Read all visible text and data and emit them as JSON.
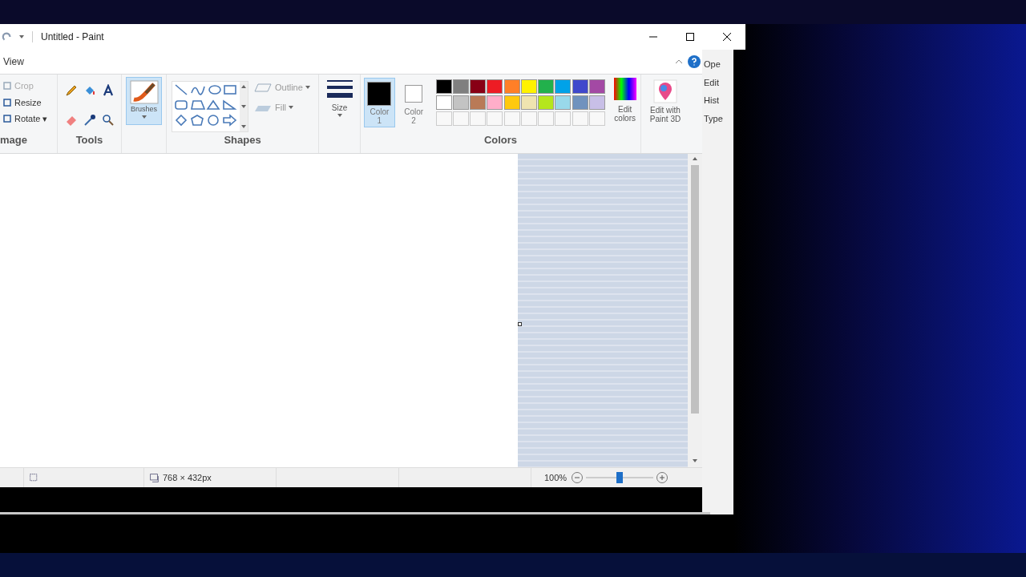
{
  "window": {
    "title": "Untitled - Paint"
  },
  "tabs": [
    {
      "label": "View",
      "selected": false
    }
  ],
  "ribbon": {
    "image": {
      "label": "mage",
      "items": [
        {
          "label": "Crop",
          "disabled": true
        },
        {
          "label": "Resize",
          "disabled": false
        },
        {
          "label": "Rotate ▾",
          "disabled": false
        }
      ]
    },
    "tools": {
      "label": "Tools"
    },
    "brushes": {
      "label": "Brushes",
      "selected": true
    },
    "shapes": {
      "label": "Shapes",
      "outline": "Outline",
      "fill": "Fill"
    },
    "size": {
      "label": "Size"
    },
    "colors": {
      "label": "Colors",
      "color1": {
        "label": "Color 1",
        "color": "#000000",
        "selected": true
      },
      "color2": {
        "label": "Color 2",
        "color": "#ffffff",
        "selected": false
      },
      "palette": [
        {
          "color": "#000000"
        },
        {
          "color": "#7f7f7f"
        },
        {
          "color": "#880015"
        },
        {
          "color": "#ed1c24"
        },
        {
          "color": "#ff7f27"
        },
        {
          "color": "#fff200"
        },
        {
          "color": "#22b14c"
        },
        {
          "color": "#00a2e8"
        },
        {
          "color": "#3f48cc"
        },
        {
          "color": "#a349a4"
        },
        {
          "color": "#ffffff"
        },
        {
          "color": "#c3c3c3"
        },
        {
          "color": "#b97a57"
        },
        {
          "color": "#ffaec9"
        },
        {
          "color": "#ffc90e"
        },
        {
          "color": "#efe4b0"
        },
        {
          "color": "#b5e61d"
        },
        {
          "color": "#99d9ea"
        },
        {
          "color": "#7092be"
        },
        {
          "color": "#c8bfe7"
        }
      ],
      "edit_colors": "Edit colors",
      "paint3d": "Edit with Paint 3D"
    }
  },
  "behind_window": {
    "items": [
      "Ope",
      "Edit",
      "Hist",
      "Type"
    ]
  },
  "status_bar": {
    "dimensions": "768 × 432px",
    "zoom": "100%",
    "zoom_slider": {
      "level": 0.5
    }
  }
}
